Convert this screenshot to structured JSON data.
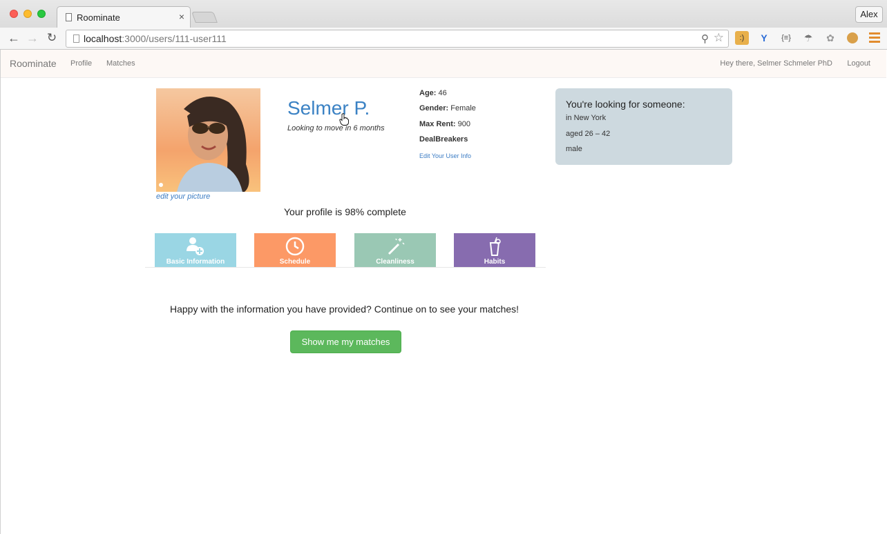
{
  "browser": {
    "tab_title": "Roominate",
    "tab_close": "×",
    "profile_name": "Alex",
    "url_host": "localhost",
    "url_path": ":3000/users/111-user111",
    "icons": [
      "back-arrow-icon",
      "forward-arrow-icon",
      "reload-icon",
      "zoom-icon",
      "bookmark-star-icon",
      "menu-icon"
    ]
  },
  "navbar": {
    "brand": "Roominate",
    "links": [
      "Profile",
      "Matches"
    ],
    "greeting": "Hey there, Selmer Schmeler PhD",
    "logout": "Logout"
  },
  "profile": {
    "name": "Selmer P.",
    "moving": "Looking to move in 6 months",
    "edit_picture": "edit your picture",
    "age_label": "Age:",
    "age": "46",
    "gender_label": "Gender:",
    "gender": "Female",
    "rent_label": "Max Rent:",
    "rent": "900",
    "dealbreakers": "DealBreakers",
    "edit_info": "Edit Your User Info",
    "completion": "Your profile is 98% complete"
  },
  "looking_for": {
    "title": "You're looking for someone:",
    "location": "in New York",
    "age_range": "aged 26 – 42",
    "gender": "male"
  },
  "categories": [
    {
      "label": "Basic Information",
      "color": "#9ad6e4",
      "icon": "add-user-icon"
    },
    {
      "label": "Schedule",
      "color": "#fc9966",
      "icon": "clock-icon"
    },
    {
      "label": "Cleanliness",
      "color": "#9ac8b4",
      "icon": "magic-wand-icon"
    },
    {
      "label": "Habits",
      "color": "#876caf",
      "icon": "drink-icon"
    }
  ],
  "cta": {
    "message": "Happy with the information you have provided? Continue on to see your matches!",
    "button": "Show me my matches"
  }
}
